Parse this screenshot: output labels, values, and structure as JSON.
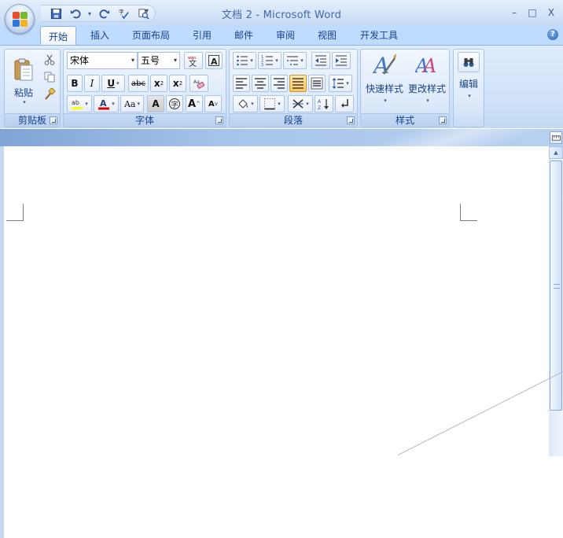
{
  "window": {
    "title": "文档 2 - Microsoft Word",
    "controls": {
      "minimize": "–",
      "maximize": "□",
      "close": "X"
    },
    "help": "?"
  },
  "quick_access": {
    "items": [
      "save-icon",
      "undo-icon",
      "redo-icon",
      "spell-check-icon",
      "print-preview-icon"
    ],
    "more": "▾"
  },
  "tabs": [
    {
      "label": "开始",
      "active": true
    },
    {
      "label": "插入"
    },
    {
      "label": "页面布局"
    },
    {
      "label": "引用"
    },
    {
      "label": "邮件"
    },
    {
      "label": "审阅"
    },
    {
      "label": "视图"
    },
    {
      "label": "开发工具"
    }
  ],
  "ribbon": {
    "clipboard": {
      "label": "剪贴板",
      "paste_label": "粘贴"
    },
    "font": {
      "label": "字体",
      "font_name": "宋体",
      "font_size": "五号",
      "bold": "B",
      "italic": "I",
      "underline": "U",
      "strike": "abc",
      "subscript": "x",
      "superscript": "x",
      "change_case": "Aa",
      "grow": "A",
      "shrink": "A",
      "char_border": "A",
      "highlight_color": "#ffff00",
      "font_color": "#e20000"
    },
    "paragraph": {
      "label": "段落"
    },
    "styles": {
      "label": "样式",
      "quick_styles": "快速样式",
      "change_styles": "更改样式"
    },
    "editing": {
      "label": "编辑"
    }
  },
  "colors": {
    "accent": "#15428b",
    "ribbon_bg": "#cfe1f8",
    "tab_bg": "#bfdbff"
  }
}
